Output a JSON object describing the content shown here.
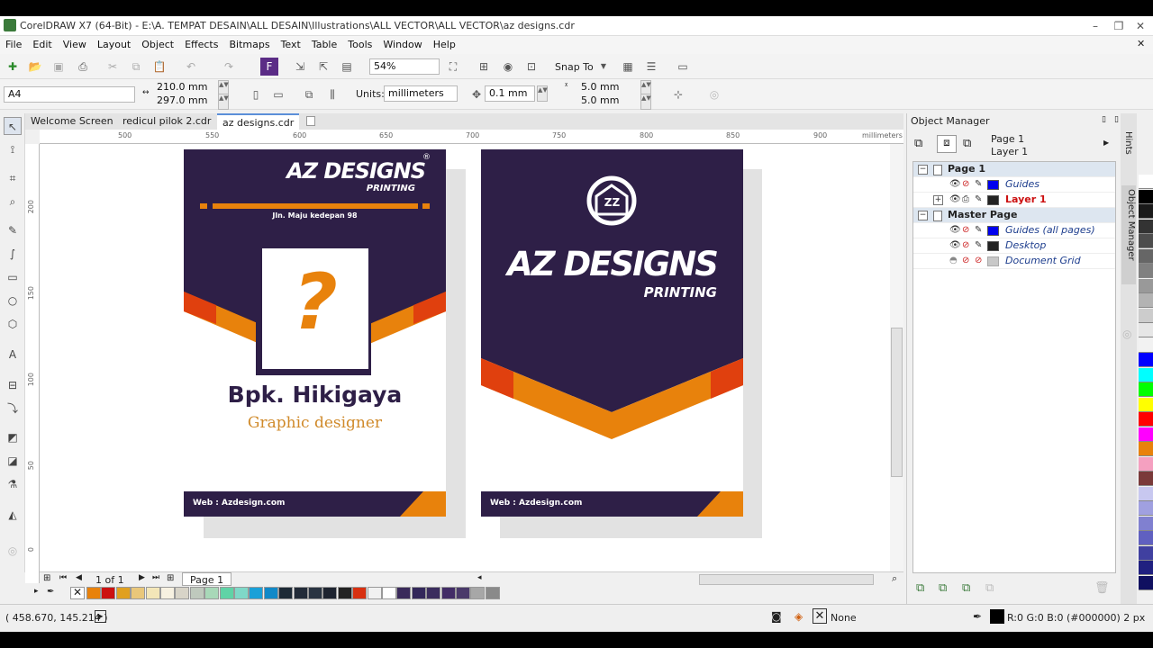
{
  "window": {
    "title": "CorelDRAW X7 (64-Bit) - E:\\A. TEMPAT DESAIN\\ALL DESAIN\\Illustrations\\ALL VECTOR\\ALL VECTOR\\az designs.cdr",
    "minimize": "–",
    "restore": "❐",
    "close": "✕"
  },
  "menu": [
    "File",
    "Edit",
    "View",
    "Layout",
    "Object",
    "Effects",
    "Bitmaps",
    "Text",
    "Table",
    "Tools",
    "Window",
    "Help"
  ],
  "toolbar": {
    "zoom_level": "54%",
    "snap_to": "Snap To"
  },
  "propertybar": {
    "page_size": "A4",
    "width": "210.0 mm",
    "height": "297.0 mm",
    "units_label": "Units:",
    "units_value": "millimeters",
    "nudge": "0.1 mm",
    "dup_x": "5.0 mm",
    "dup_y": "5.0 mm"
  },
  "tabs": [
    "Welcome Screen",
    "redicul pilok 2.cdr",
    "az designs.cdr"
  ],
  "ruler": {
    "h_ticks": [
      "500",
      "550",
      "600",
      "650",
      "700",
      "750",
      "800",
      "850",
      "900"
    ],
    "h_unit": "millimeters",
    "v_ticks": [
      "200",
      "150",
      "100",
      "50",
      "0"
    ],
    "v_unit": "millimeters"
  },
  "design": {
    "brand": "AZ DESIGNS",
    "brand_sub": "PRINTING",
    "registered": "®",
    "address": "Jln. Maju kedepan 98",
    "logo_glyph": "?",
    "emblem_text": "ZZ",
    "person_name": "Bpk. Hikigaya",
    "person_role": "Graphic designer",
    "web": "Web : Azdesign.com",
    "colors": {
      "navy": "#2e1f47",
      "orange": "#e8820c",
      "red_orange": "#e0400e"
    }
  },
  "pagenav": {
    "page_count": "1 of 1",
    "page_tab": "Page 1"
  },
  "palette_bottom": [
    "#e8820c",
    "#cc1111",
    "#e0a020",
    "#e9c77a",
    "#f3e6b8",
    "#f7f1e1",
    "#d8d4c8",
    "#bfc9bd",
    "#a8d8b8",
    "#5fd3a6",
    "#7fd8c8",
    "#1aa0d8",
    "#1189c8",
    "#1d2a36",
    "#222b38",
    "#2a3442",
    "#1e2430",
    "#222222",
    "#d83010",
    "#f1f1f1",
    "#ffffff",
    "#3a2a5a",
    "#33285a",
    "#3b2d5e",
    "#422d66",
    "#4a3a6a",
    "#a7a7a7",
    "#8a8a8a"
  ],
  "palette_right": [
    "#ffffff",
    "#000000",
    "#1a1a1a",
    "#333333",
    "#4d4d4d",
    "#666666",
    "#808080",
    "#999999",
    "#b3b3b3",
    "#cccccc",
    "#e6e6e6",
    "#f2f2f2",
    "#0000ff",
    "#00ffff",
    "#00ff00",
    "#ffff00",
    "#ff0000",
    "#ff00ff",
    "#e8820c",
    "#f5a0c0",
    "#7a3a3a",
    "#c8c8f0",
    "#a0a0e0",
    "#8080d0",
    "#6060c0",
    "#4040a0",
    "#202080",
    "#101060"
  ],
  "status": {
    "coords": "( 458.670, 145.214 )",
    "fill": "None",
    "outline": "R:0 G:0 B:0 (#000000)  2 px"
  },
  "object_manager": {
    "title": "Object Manager",
    "current_page": "Page 1",
    "current_layer": "Layer 1",
    "rows": [
      {
        "name": "Page 1",
        "type": "group"
      },
      {
        "name": "Guides",
        "type": "layer",
        "color": "#0000ee"
      },
      {
        "name": "Layer 1",
        "type": "layer-active",
        "color": "#222222"
      },
      {
        "name": "Master Page",
        "type": "group"
      },
      {
        "name": "Guides (all pages)",
        "type": "layer",
        "color": "#0000ee"
      },
      {
        "name": "Desktop",
        "type": "layer",
        "color": "#222222"
      },
      {
        "name": "Document Grid",
        "type": "layer",
        "color": "#c8c8c8"
      }
    ],
    "side_tabs": [
      "Hints",
      "Object Manager"
    ]
  }
}
